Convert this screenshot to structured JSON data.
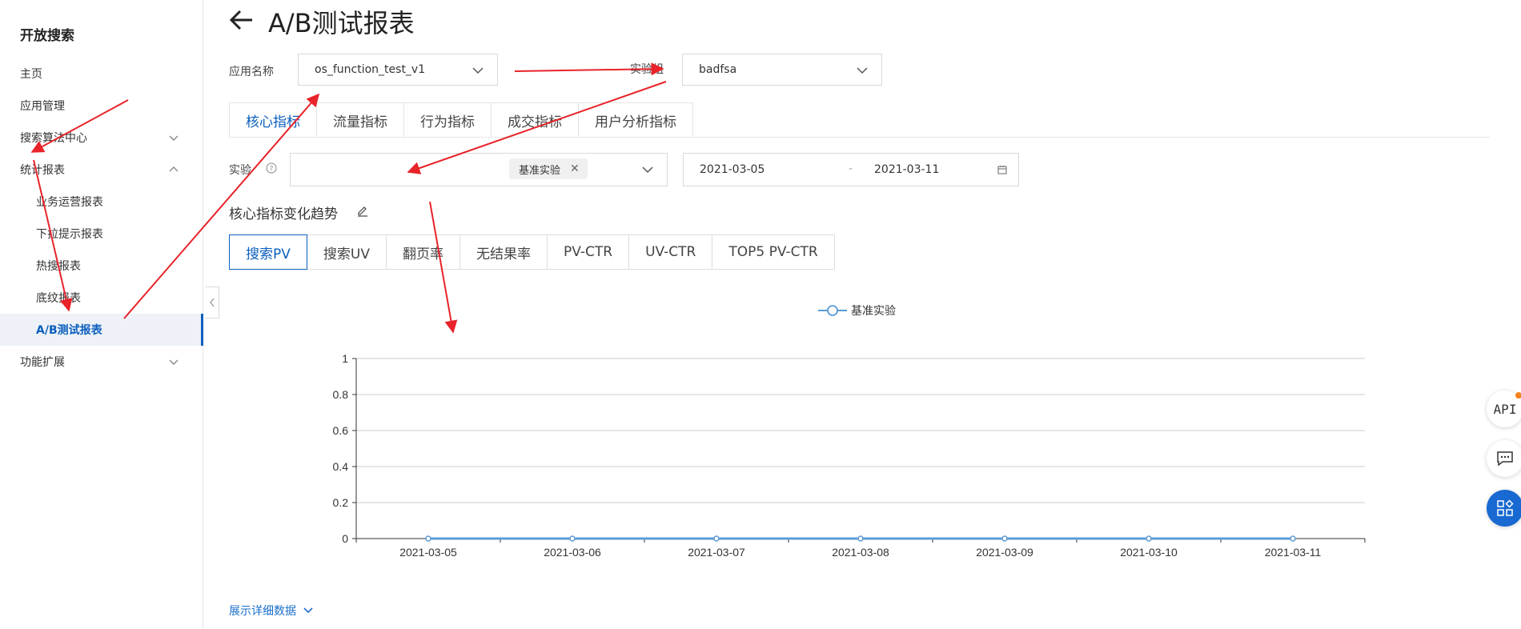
{
  "sidebar": {
    "title": "开放搜索",
    "items": [
      {
        "label": "主页"
      },
      {
        "label": "应用管理"
      },
      {
        "label": "搜索算法中心"
      },
      {
        "label": "统计报表"
      },
      {
        "label": "业务运营报表"
      },
      {
        "label": "下拉提示报表"
      },
      {
        "label": "热搜报表"
      },
      {
        "label": "底纹报表"
      },
      {
        "label": "A/B测试报表"
      },
      {
        "label": "功能扩展"
      }
    ]
  },
  "header": {
    "title": "A/B测试报表"
  },
  "filters": {
    "app_label": "应用名称",
    "app_value": "os_function_test_v1",
    "group_label": "实验组",
    "group_value": "badfsa",
    "experiment_label": "实验",
    "experiment_tag": "基准实验",
    "date_start": "2021-03-05",
    "date_sep": "-",
    "date_end": "2021-03-11"
  },
  "tabs": [
    "核心指标",
    "流量指标",
    "行为指标",
    "成交指标",
    "用户分析指标"
  ],
  "section_title": "核心指标变化趋势",
  "metric_tabs": [
    "搜索PV",
    "搜索UV",
    "翻页率",
    "无结果率",
    "PV-CTR",
    "UV-CTR",
    "TOP5 PV-CTR"
  ],
  "expand_link": "展示详细数据",
  "float": {
    "api": "API"
  },
  "colors": {
    "accent": "#0b5fbd",
    "series": "#5b9bd5",
    "annotation": "#e8232a"
  },
  "chart_data": {
    "type": "line",
    "x": [
      "2021-03-05",
      "2021-03-06",
      "2021-03-07",
      "2021-03-08",
      "2021-03-09",
      "2021-03-10",
      "2021-03-11"
    ],
    "series": [
      {
        "name": "基准实验",
        "values": [
          0,
          0,
          0,
          0,
          0,
          0,
          0
        ]
      }
    ],
    "ylim": [
      0,
      1
    ],
    "yticks": [
      "0",
      "0.2",
      "0.4",
      "0.6",
      "0.8",
      "1"
    ],
    "legend": "top-center",
    "grid": true
  }
}
